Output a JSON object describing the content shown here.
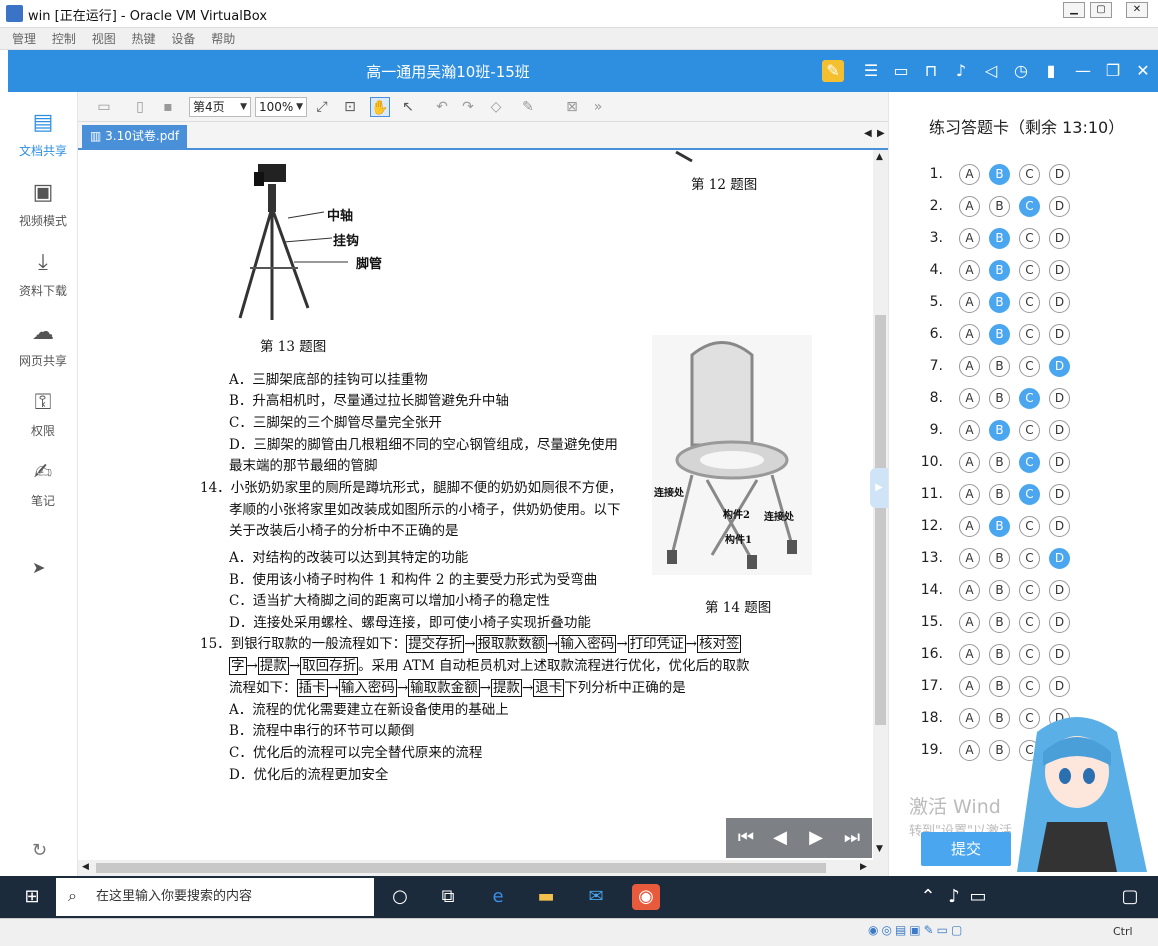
{
  "vbox": {
    "window_title": "win [正在运行] - Oracle VM VirtualBox",
    "menu": [
      "管理",
      "控制",
      "视图",
      "热键",
      "设备",
      "帮助"
    ],
    "host_key": "Ctrl"
  },
  "app": {
    "title": "高一通用吴瀚10班-15班"
  },
  "sidebar": {
    "items": [
      {
        "label": "文档共享",
        "icon": "document-share-icon",
        "active": true
      },
      {
        "label": "视频模式",
        "icon": "video-mode-icon",
        "active": false
      },
      {
        "label": "资料下载",
        "icon": "download-icon",
        "active": false
      },
      {
        "label": "网页共享",
        "icon": "web-share-icon",
        "active": false
      },
      {
        "label": "权限",
        "icon": "permission-icon",
        "active": false
      },
      {
        "label": "笔记",
        "icon": "note-icon",
        "active": false
      }
    ]
  },
  "toolbar": {
    "page_select": "第4页",
    "zoom_select": "100%"
  },
  "tab": {
    "file_name": "3.10试卷.pdf"
  },
  "doc": {
    "fig12_caption": "第 12 题图",
    "fig13_caption": "第 13 题图",
    "fig13_labels": [
      "中轴",
      "挂钩",
      "脚管"
    ],
    "q13_options": [
      "A．三脚架底部的挂钩可以挂重物",
      "B．升高相机时，尽量通过拉长脚管避免升中轴",
      "C．三脚架的三个脚管尽量完全张开",
      "D．三脚架的脚管由几根粗细不同的空心钢管组成，尽量避免使用",
      "最末端的那节最细的管脚"
    ],
    "q14_lines": [
      "14．小张奶奶家里的厕所是蹲坑形式，腿脚不便的奶奶如厕很不方便，",
      "孝顺的小张将家里如改装成如图所示的小椅子，供奶奶使用。以下",
      "关于改装后小椅子的分析中不正确的是"
    ],
    "q14_options": [
      "A．对结构的改装可以达到其特定的功能",
      "B．使用该小椅子时构件 1 和构件 2 的主要受力形式为受弯曲",
      "C．适当扩大椅脚之间的距离可以增加小椅子的稳定性",
      "D．连接处采用螺栓、螺母连接，即可使小椅子实现折叠功能"
    ],
    "fig14_caption": "第 14 题图",
    "fig14_labels": [
      "连接处",
      "构件2",
      "连接处",
      "构件1"
    ],
    "q15_intro": "15．到银行取款的一般流程如下：",
    "q15_flow1": [
      "提交存折",
      "报取款数额",
      "输入密码",
      "打印凭证",
      "核对签"
    ],
    "q15_flow1b": [
      "字",
      "提款",
      "取回存折"
    ],
    "q15_mid": "。采用 ATM 自动柜员机对上述取款流程进行优化，优化后的取款",
    "q15_line3_prefix": "流程如下：",
    "q15_flow2": [
      "插卡",
      "输入密码",
      "输取款金额",
      "提款",
      "退卡"
    ],
    "q15_line3_suffix": "下列分析中正确的是",
    "arrow": "→",
    "q15_options": [
      "A．流程的优化需要建立在新设备使用的基础上",
      "B．流程中串行的环节可以颠倒",
      "C．优化后的流程可以完全替代原来的流程",
      "D．优化后的流程更加安全"
    ]
  },
  "answer_card": {
    "title": "练习答题卡（剩余 13:10）",
    "options": [
      "A",
      "B",
      "C",
      "D"
    ],
    "questions": [
      {
        "num": "1.",
        "selected": "B"
      },
      {
        "num": "2.",
        "selected": "C"
      },
      {
        "num": "3.",
        "selected": "B"
      },
      {
        "num": "4.",
        "selected": "B"
      },
      {
        "num": "5.",
        "selected": "B"
      },
      {
        "num": "6.",
        "selected": "B"
      },
      {
        "num": "7.",
        "selected": "D"
      },
      {
        "num": "8.",
        "selected": "C"
      },
      {
        "num": "9.",
        "selected": "B"
      },
      {
        "num": "10.",
        "selected": "C"
      },
      {
        "num": "11.",
        "selected": "C"
      },
      {
        "num": "12.",
        "selected": "B"
      },
      {
        "num": "13.",
        "selected": "D"
      },
      {
        "num": "14.",
        "selected": null
      },
      {
        "num": "15.",
        "selected": null
      },
      {
        "num": "16.",
        "selected": null
      },
      {
        "num": "17.",
        "selected": null
      },
      {
        "num": "18.",
        "selected": null
      },
      {
        "num": "19.",
        "selected": null
      }
    ],
    "submit_label": "提交",
    "watermark_line1": "激活 Wind",
    "watermark_line2": "转到\"设置\"以激活"
  },
  "taskbar": {
    "search_placeholder": "在这里输入你要搜索的内容"
  },
  "colors": {
    "header_blue": "#2e8fe0",
    "selected_option": "#4aa6ee",
    "tab_blue": "#4a90d9"
  }
}
